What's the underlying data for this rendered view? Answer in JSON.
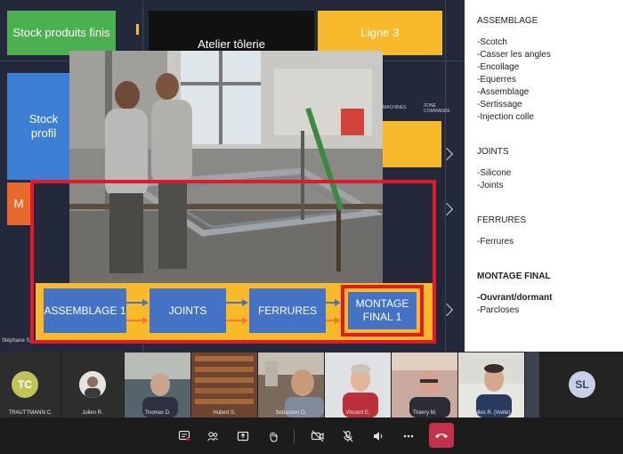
{
  "stage": {
    "stock_finis": "Stock produits finis",
    "stock_profil": "Stock profil",
    "orange_letter": "M",
    "atelier": "Atelier tôlerie",
    "ligne3": "Ligne 3",
    "presenter": "Stéphane S.",
    "tiny_labels": [
      "MACHINES",
      "ZONE COMMANDE"
    ]
  },
  "process": {
    "steps": [
      "ASSEMBLAGE 1",
      "JOINTS",
      "FERRURES",
      "MONTAGE FINAL 1"
    ]
  },
  "notes": {
    "sections": [
      {
        "title": "ASSEMBLAGE",
        "bold_title": false,
        "items": [
          "-Scotch",
          "-Casser les angles",
          "-Encollage",
          "-Equerres",
          "-Assemblage",
          "-Sertissage",
          "-Injection colle"
        ]
      },
      {
        "title": "JOINTS",
        "bold_title": false,
        "items": [
          "-Silicone",
          "-Joints"
        ]
      },
      {
        "title": "FERRURES",
        "bold_title": false,
        "items": [
          "-Ferrures"
        ]
      },
      {
        "title": "MONTAGE FINAL",
        "bold_title": true,
        "items": [
          "-Ouvrant/dormant",
          "-Parcloses"
        ]
      }
    ]
  },
  "participants": [
    {
      "initials": "TC",
      "name": "TRAUTTMANN C."
    },
    {
      "name": "Julien R."
    },
    {
      "name": "Thomas D."
    },
    {
      "name": "Hubert S."
    },
    {
      "name": "Sebastien O."
    },
    {
      "name": "Vincent E."
    },
    {
      "name": "Thierry M."
    },
    {
      "name": "Gilles R. (Invité)"
    },
    {
      "initials": "SL"
    }
  ],
  "toolbar": {
    "icons": [
      "chat-icon",
      "people-icon",
      "share-icon",
      "raise-hand-icon",
      "camera-off-icon",
      "mic-off-icon",
      "speaker-icon",
      "more-icon",
      "hang-up-icon"
    ]
  },
  "colors": {
    "green": "#4caf50",
    "blue": "#3d7fd4",
    "orange": "#e8692a",
    "yellow": "#f8b92b",
    "red": "#e3192b",
    "step_blue": "#4472c4",
    "hangup": "#c4314b",
    "avatar_tc": "#c4c35a",
    "avatar_sl": "#c8d0e6"
  }
}
